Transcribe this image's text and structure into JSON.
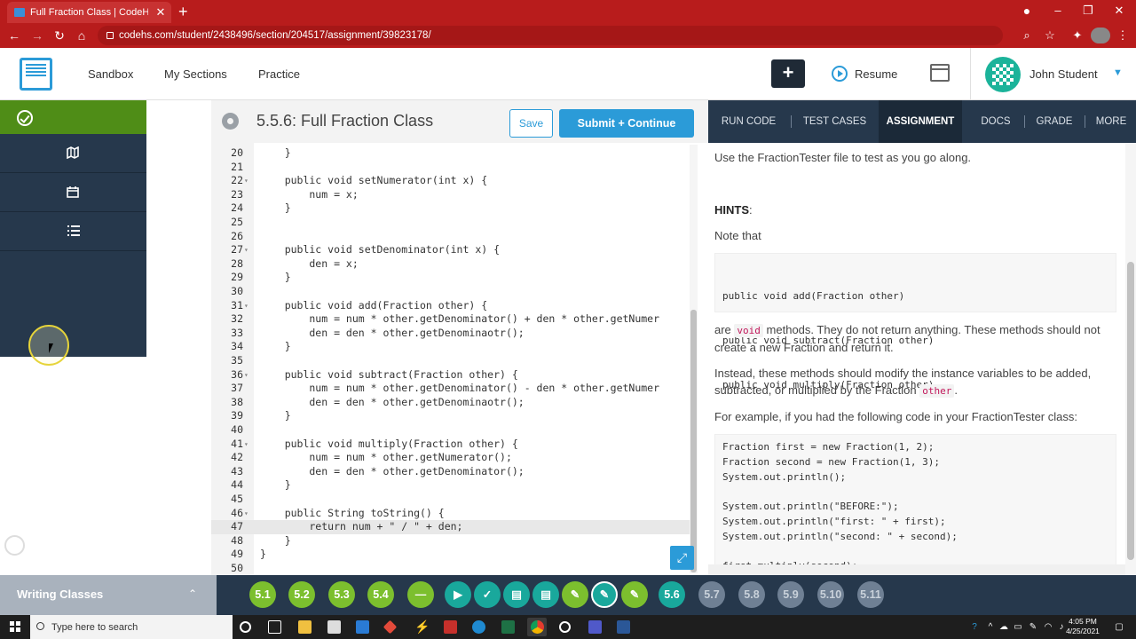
{
  "browser": {
    "tab_title": "Full Fraction Class | CodeHS",
    "tab_close": "✕",
    "new_tab": "+",
    "url": "codehs.com/student/2438496/section/204517/assignment/39823178/",
    "back": "←",
    "forward": "→",
    "reload": "↻",
    "home": "⌂"
  },
  "header": {
    "nav": [
      "Sandbox",
      "My Sections",
      "Practice"
    ],
    "plus_label": "+",
    "resume_label": "Resume",
    "user_name": "John Student",
    "user_caret": "▼"
  },
  "editor": {
    "title": "5.5.6: Full Fraction Class",
    "save_label": "Save",
    "submit_label": "Submit + Continue",
    "expand": "⤢"
  },
  "code_lines": [
    {
      "n": "20",
      "fold": "",
      "text": "    }"
    },
    {
      "n": "21",
      "fold": "",
      "text": ""
    },
    {
      "n": "22",
      "fold": "▾",
      "text": "    public void setNumerator(int x) {"
    },
    {
      "n": "23",
      "fold": "",
      "text": "        num = x;"
    },
    {
      "n": "24",
      "fold": "",
      "text": "    }"
    },
    {
      "n": "25",
      "fold": "",
      "text": ""
    },
    {
      "n": "26",
      "fold": "",
      "text": ""
    },
    {
      "n": "27",
      "fold": "▾",
      "text": "    public void setDenominator(int x) {"
    },
    {
      "n": "28",
      "fold": "",
      "text": "        den = x;"
    },
    {
      "n": "29",
      "fold": "",
      "text": "    }"
    },
    {
      "n": "30",
      "fold": "",
      "text": ""
    },
    {
      "n": "31",
      "fold": "▾",
      "text": "    public void add(Fraction other) {"
    },
    {
      "n": "32",
      "fold": "",
      "text": "        num = num * other.getDenominator() + den * other.getNumer"
    },
    {
      "n": "33",
      "fold": "",
      "text": "        den = den * other.getDenominaotr();"
    },
    {
      "n": "34",
      "fold": "",
      "text": "    }"
    },
    {
      "n": "35",
      "fold": "",
      "text": ""
    },
    {
      "n": "36",
      "fold": "▾",
      "text": "    public void subtract(Fraction other) {"
    },
    {
      "n": "37",
      "fold": "",
      "text": "        num = num * other.getDenominator() - den * other.getNumer"
    },
    {
      "n": "38",
      "fold": "",
      "text": "        den = den * other.getDenominaotr();"
    },
    {
      "n": "39",
      "fold": "",
      "text": "    }"
    },
    {
      "n": "40",
      "fold": "",
      "text": ""
    },
    {
      "n": "41",
      "fold": "▾",
      "text": "    public void multiply(Fraction other) {"
    },
    {
      "n": "42",
      "fold": "",
      "text": "        num = num * other.getNumerator();"
    },
    {
      "n": "43",
      "fold": "",
      "text": "        den = den * other.getDenominator();"
    },
    {
      "n": "44",
      "fold": "",
      "text": "    }"
    },
    {
      "n": "45",
      "fold": "",
      "text": ""
    },
    {
      "n": "46",
      "fold": "▾",
      "text": "    public String toString() {"
    },
    {
      "n": "47",
      "fold": "",
      "text": "        return num + \" / \" + den;"
    },
    {
      "n": "48",
      "fold": "",
      "text": "    }"
    },
    {
      "n": "49",
      "fold": "",
      "text": "}"
    },
    {
      "n": "50",
      "fold": "",
      "text": ""
    }
  ],
  "right_tabs": [
    "RUN CODE",
    "TEST CASES",
    "ASSIGNMENT",
    "DOCS",
    "GRADE",
    "MORE"
  ],
  "assignment": {
    "intro": "Use the FractionTester file to test as you go along.",
    "hints_label": "HINTS",
    "hints_colon": ":",
    "note": "Note that",
    "methods_code": [
      "public void add(Fraction other)",
      "public void subtract(Fraction other)",
      "public void multiply(Fraction other)"
    ],
    "are": "are",
    "void_word": "void",
    "void_rest": "methods. They do not return anything. These methods should not create a new Fraction and return it.",
    "instead": "Instead, these methods should modify the instance variables to be added, subtracted, or multiplied by the Fraction",
    "other_word": "other",
    "period": ".",
    "example_intro": "For example, if you had the following code in your FractionTester class:",
    "example_code": [
      "Fraction first = new Fraction(1, 2);",
      "Fraction second = new Fraction(1, 3);",
      "System.out.println();",
      "",
      "System.out.println(\"BEFORE:\");",
      "System.out.println(\"first: \" + first);",
      "System.out.println(\"second: \" + second);",
      "",
      "first.multiply(second);"
    ]
  },
  "bottom": {
    "section_label": "Writing Classes",
    "caret": "⌃",
    "bubbles": [
      "5.1",
      "5.2",
      "5.3",
      "5.4",
      "5.6",
      "5.7",
      "5.8",
      "5.9",
      "5.10",
      "5.11"
    ]
  },
  "taskbar": {
    "search_placeholder": "Type here to search",
    "time": "4:05 PM",
    "date": "4/25/2021"
  },
  "colors": {
    "browser_red": "#b81c1c",
    "accent_blue": "#2b9bd8",
    "sidebar_navy": "#26384c",
    "complete_green": "#4f8d17",
    "bubble_green": "#7cbf2e",
    "bubble_teal": "#19a89c"
  }
}
